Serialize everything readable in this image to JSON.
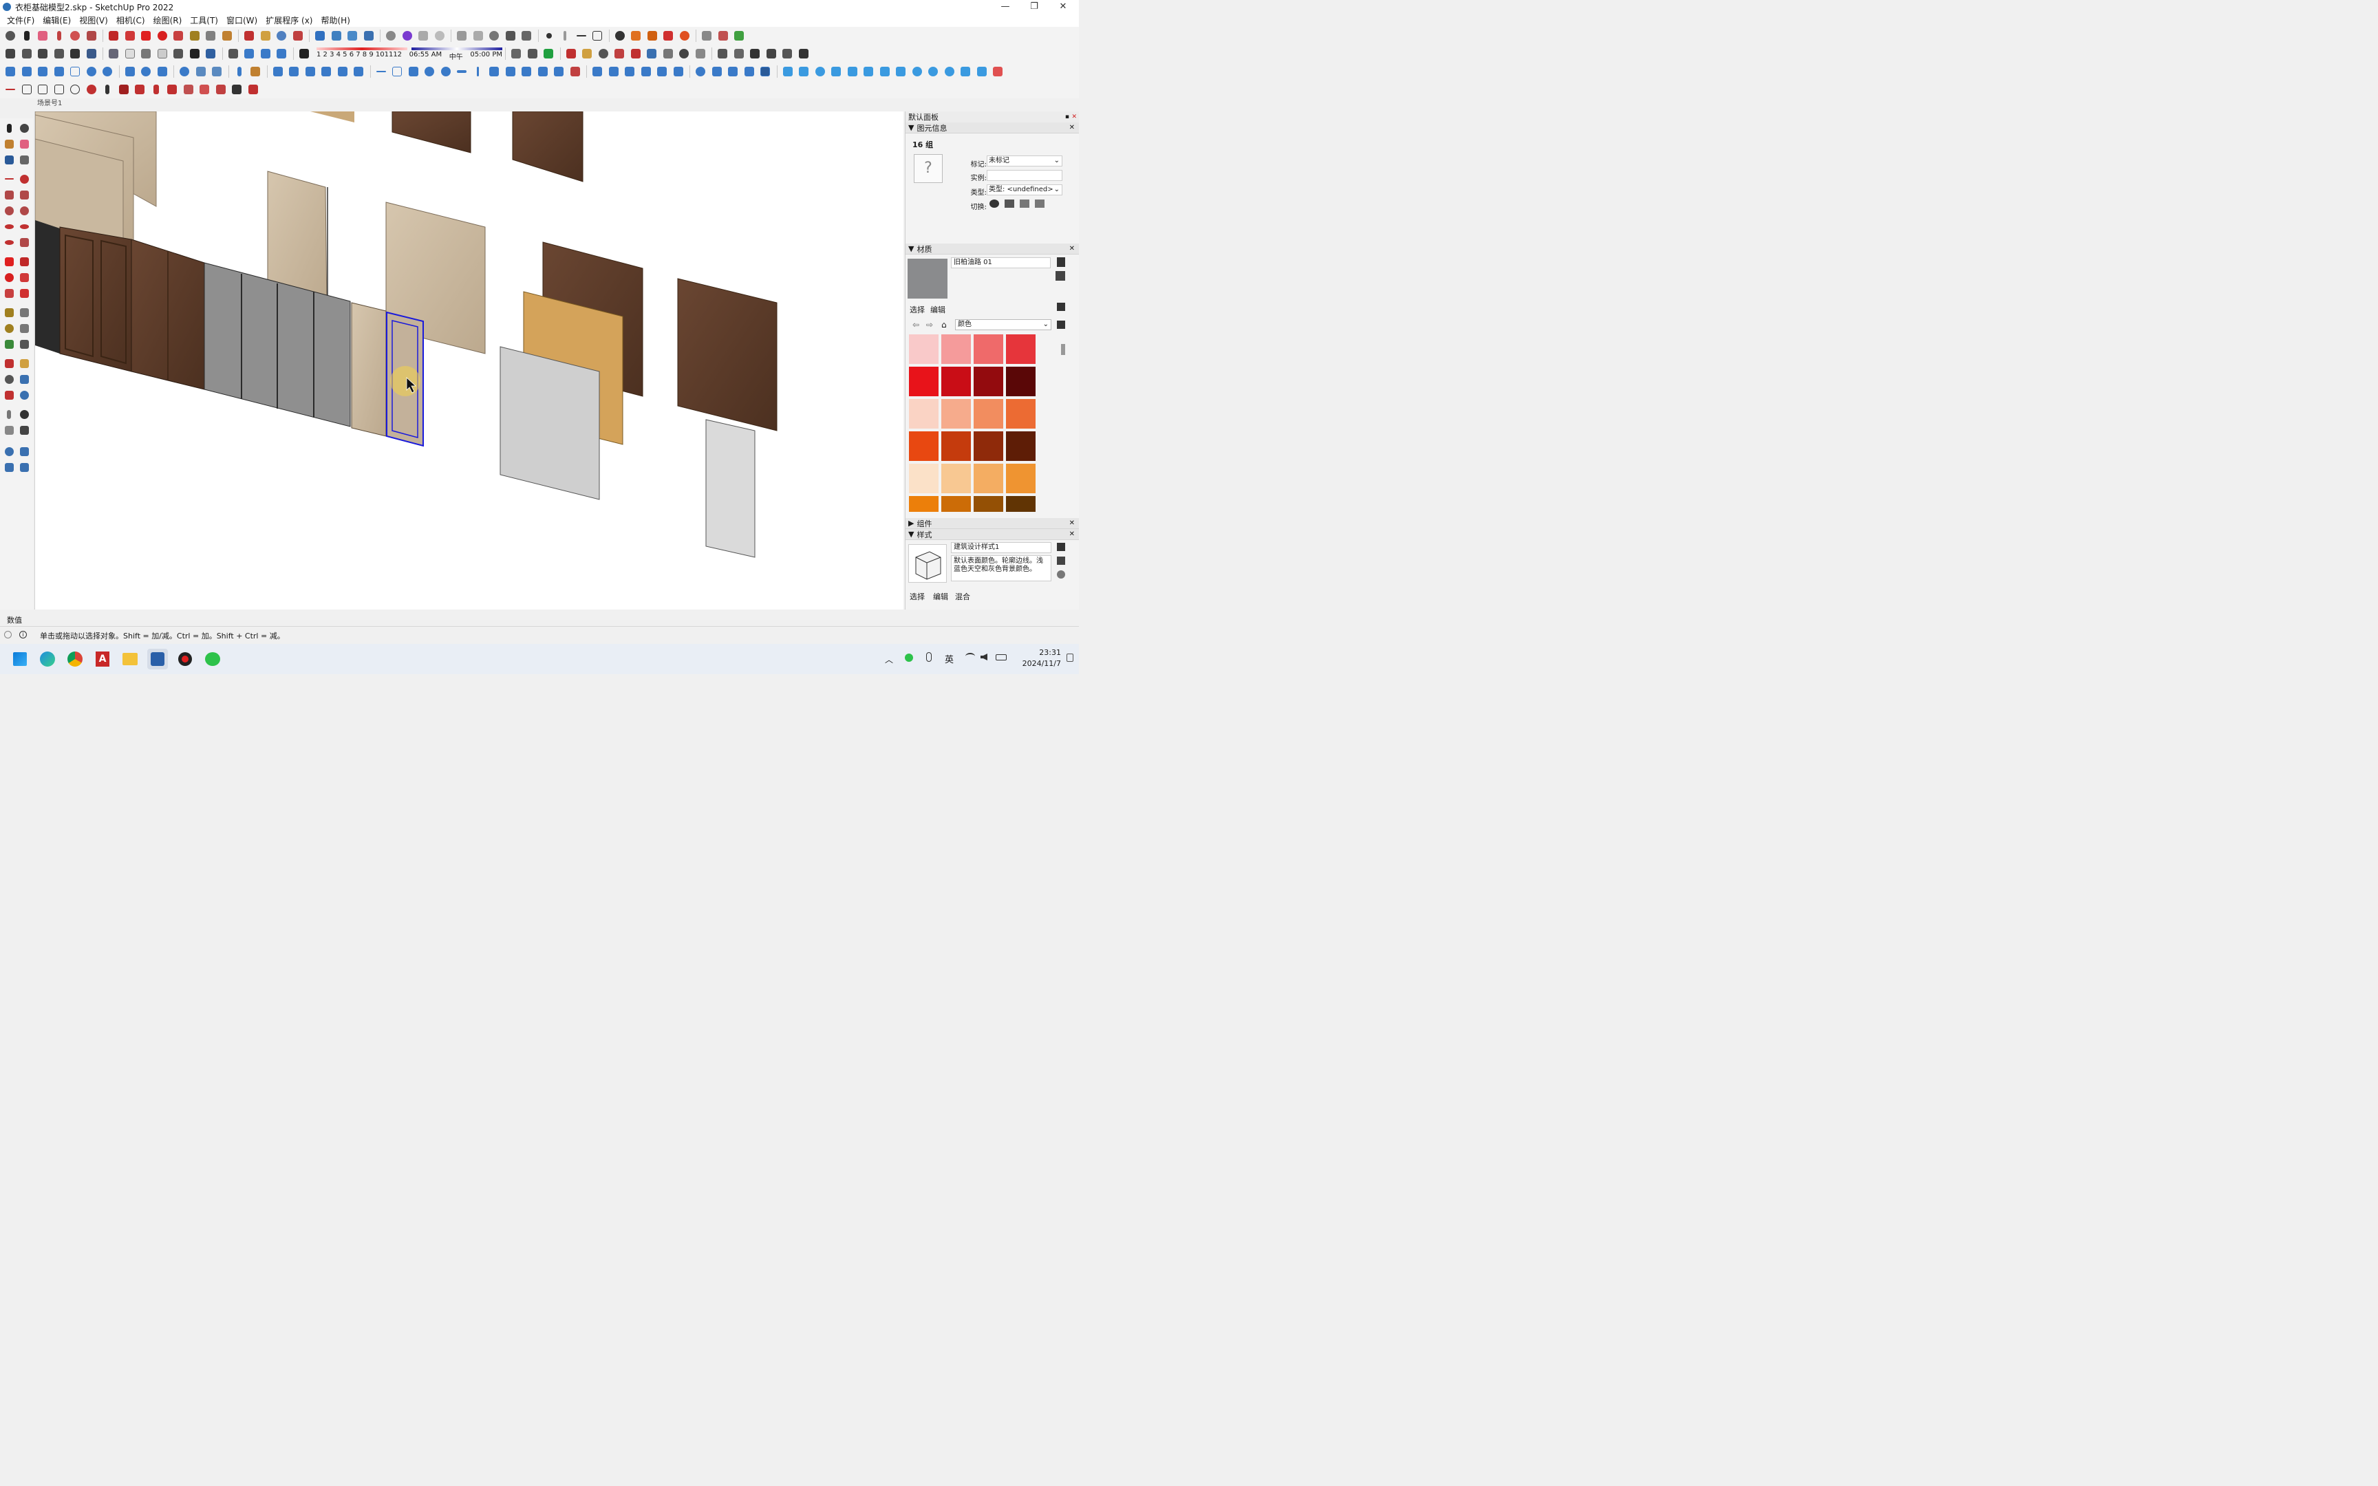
{
  "window": {
    "title": "衣柜基础模型2.skp - SketchUp Pro 2022",
    "minimize": "—",
    "maximize": "❐",
    "close": "✕"
  },
  "menu": [
    "文件(F)",
    "编辑(E)",
    "视图(V)",
    "相机(C)",
    "绘图(R)",
    "工具(T)",
    "窗口(W)",
    "扩展程序 (x)",
    "帮助(H)"
  ],
  "timeline": {
    "months": "1 2 3 4 5 6 7 8 9 101112",
    "time_start": "06:55 AM",
    "noon": "中午",
    "time_end": "05:00 PM"
  },
  "scene_tab": "场景号1",
  "default_panel": {
    "title": "默认面板",
    "entity_info": {
      "header": "图元信息",
      "selection": "16 组",
      "tag_label": "标记:",
      "tag_value": "未标记",
      "instance_label": "实例:",
      "instance_value": "",
      "type_label": "类型:",
      "type_value": "类型: <undefined>",
      "toggle_label": "切换:"
    },
    "materials": {
      "header": "材质",
      "current_name": "旧柏油路 01",
      "tab_select": "选择",
      "tab_edit": "编辑",
      "library": "颜色",
      "swatches": [
        "#f9c9c9",
        "#f59b9b",
        "#ef6a6a",
        "#e6353b",
        "#e8131a",
        "#c90d16",
        "#930b0e",
        "#5a0707",
        "#fad3c4",
        "#f6ab8c",
        "#f28d5f",
        "#ec6b33",
        "#e84811",
        "#c53b0d",
        "#8f2a0a",
        "#5e1d06",
        "#fbe1c8",
        "#f8c892",
        "#f4ad62",
        "#ef9431",
        "#ec7f0a",
        "#cc6c07",
        "#945005",
        "#613404"
      ]
    },
    "components": {
      "header": "组件"
    },
    "styles": {
      "header": "样式",
      "name": "建筑设计样式1",
      "description": "默认表面颜色。轮廓边线。浅蓝色天空和灰色背景颜色。",
      "tab_select": "选择",
      "tab_edit": "编辑",
      "tab_mix": "混合"
    }
  },
  "status": {
    "measure_label": "数值",
    "hint": "单击或拖动以选择对象。Shift = 加/减。Ctrl = 加。Shift + Ctrl = 减。"
  },
  "taskbar": {
    "ime": "英",
    "time": "23:31",
    "date": "2024/11/7"
  },
  "colors": {
    "selection_blue": "#1a1adb",
    "dark_wood": "#5a3a28",
    "light_wood": "#c8b49a",
    "cork": "#d4a35a",
    "glass": "#8c8c8c"
  }
}
